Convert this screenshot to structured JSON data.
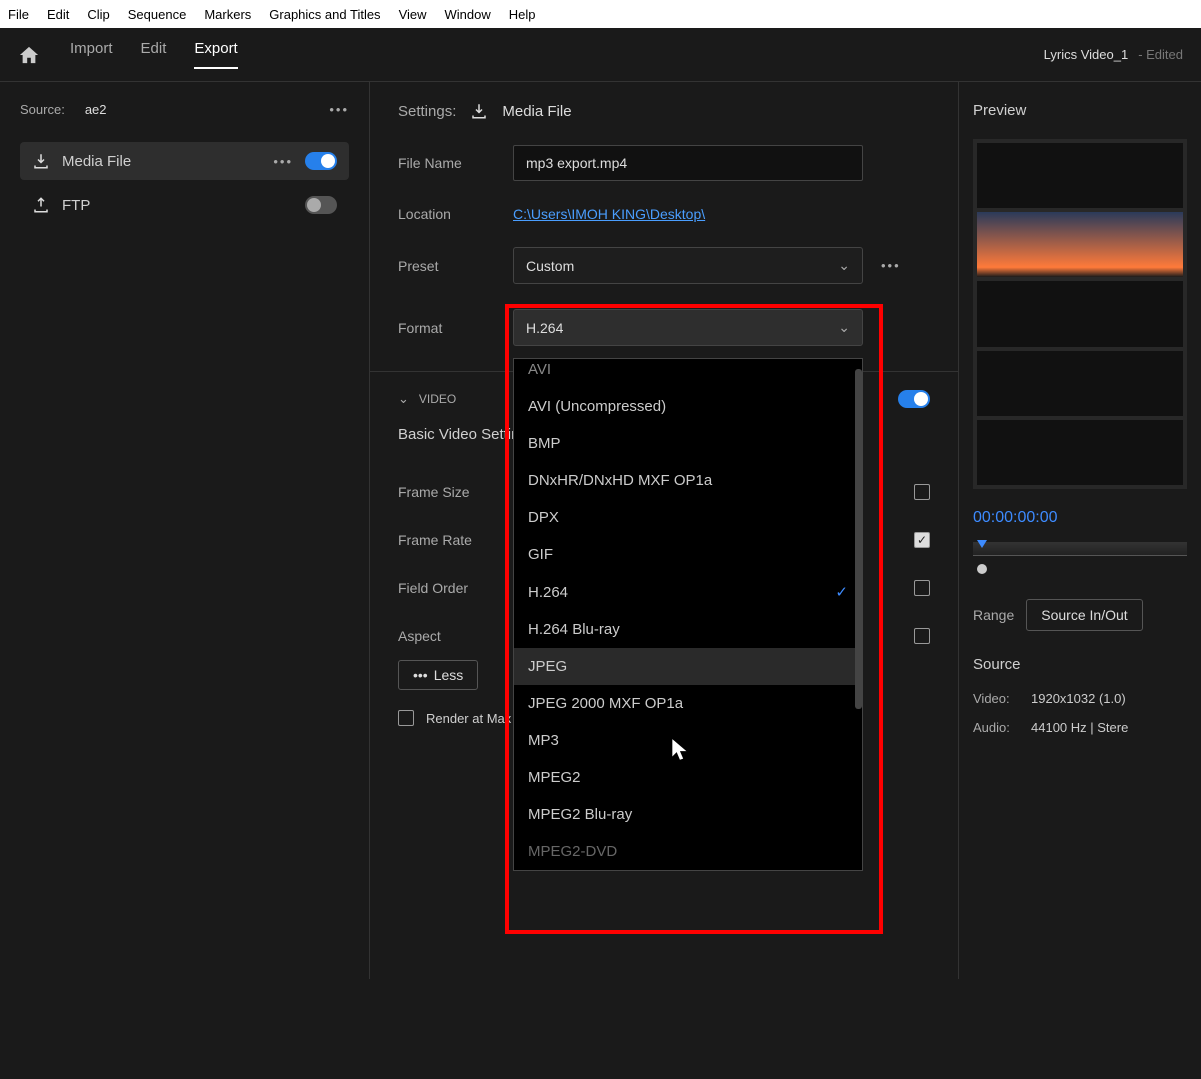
{
  "menu": [
    "File",
    "Edit",
    "Clip",
    "Sequence",
    "Markers",
    "Graphics and Titles",
    "View",
    "Window",
    "Help"
  ],
  "header": {
    "tabs": [
      "Import",
      "Edit",
      "Export"
    ],
    "active_tab": "Export",
    "project_name": "Lyrics Video_1",
    "project_status": "- Edited"
  },
  "left": {
    "source_label": "Source:",
    "source_value": "ae2",
    "destinations": [
      {
        "label": "Media File",
        "active": true,
        "toggle": true
      },
      {
        "label": "FTP",
        "active": false,
        "toggle": false
      }
    ]
  },
  "settings": {
    "header_label": "Settings:",
    "header_value": "Media File",
    "file_name_label": "File Name",
    "file_name_value": "mp3 export.mp4",
    "location_label": "Location",
    "location_value": "C:\\Users\\IMOH KING\\Desktop\\",
    "preset_label": "Preset",
    "preset_value": "Custom",
    "format_label": "Format",
    "format_value": "H.264",
    "format_options": [
      "AVI",
      "AVI (Uncompressed)",
      "BMP",
      "DNxHR/DNxHD MXF OP1a",
      "DPX",
      "GIF",
      "H.264",
      "H.264 Blu-ray",
      "JPEG",
      "JPEG 2000 MXF OP1a",
      "MP3",
      "MPEG2",
      "MPEG2 Blu-ray",
      "MPEG2-DVD"
    ],
    "format_selected": "H.264",
    "format_hovered": "JPEG",
    "video_section": "VIDEO",
    "basic_heading": "Basic Video Settings",
    "rows": {
      "frame_size": "Frame Size",
      "frame_rate": "Frame Rate",
      "field_order": "Field Order",
      "aspect": "Aspect"
    },
    "less_btn": "Less",
    "render_label": "Render at Max"
  },
  "preview": {
    "title": "Preview",
    "timecode": "00:00:00:00",
    "range_label": "Range",
    "range_value": "Source In/Out",
    "source_title": "Source",
    "video_label": "Video:",
    "video_value": "1920x1032 (1.0)",
    "audio_label": "Audio:",
    "audio_value": "44100 Hz | Stere"
  }
}
